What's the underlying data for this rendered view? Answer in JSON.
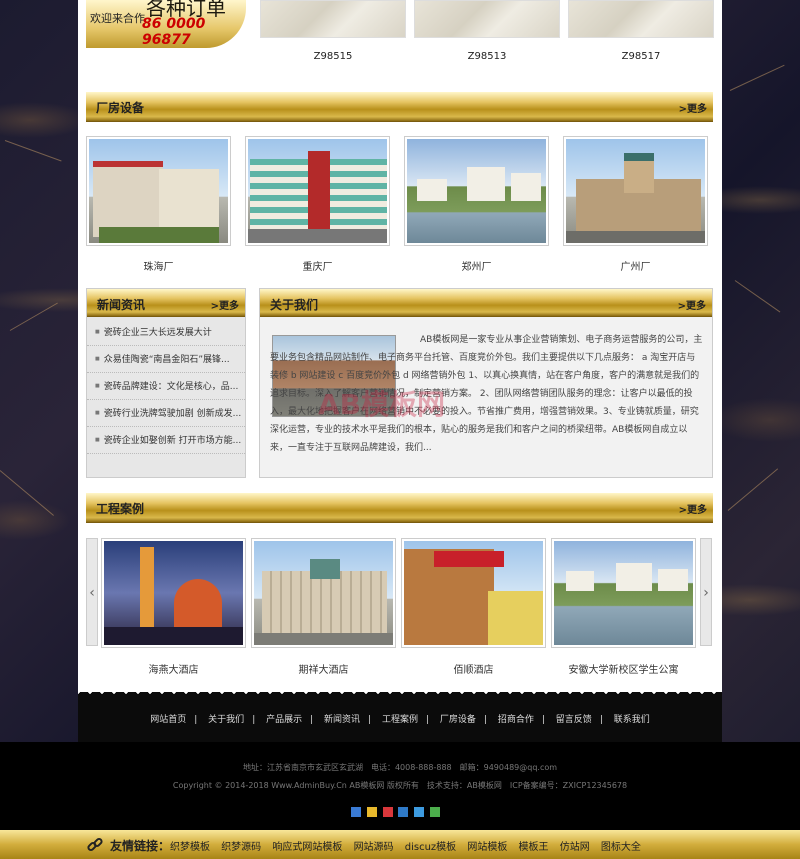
{
  "promo": {
    "line_big": "各种订单",
    "line_small": "欢迎来合作",
    "phone": "86 0000 96877"
  },
  "stones": [
    {
      "code": "Z98515"
    },
    {
      "code": "Z98513"
    },
    {
      "code": "Z98517"
    }
  ],
  "factory": {
    "title": "厂房设备",
    "more": ">更多",
    "items": [
      "珠海厂",
      "重庆厂",
      "郑州厂",
      "广州厂"
    ]
  },
  "news": {
    "title": "新闻资讯",
    "more": ">更多",
    "items": [
      "瓷砖企业三大长远发展大计",
      "众易佳陶瓷“南昌金阳石”展锋...",
      "瓷砖品牌建设：文化是核心，品...",
      "瓷砖行业洗牌驾驶加剧 创新成发...",
      "瓷砖企业如娶创新 打开市场方能..."
    ]
  },
  "about": {
    "title": "关于我们",
    "more": ">更多",
    "text": "AB模板网是一家专业从事企业营销策划、电子商务运营服务的公司，主要业务包含精品网站制作、电子商务平台托管、百度竞价外包。我们主要提供以下几点服务： a 淘宝开店与装修 b 网站建设 c 百度竞价外包 d 网络营销外包 1、以真心换真情，站在客户角度，客户的满意就是我们的追求目标。深入了解客户营销情况，制定营销方案。 2、团队网络营销团队服务的理念：让客户以最低的投入，最大化地把握客户在网络营销中不必要的投入。节省推广费用，增强营销效果。3、专业铸就质量，研究深化运营，专业的技术水平是我们的根本，贴心的服务是我们和客户之间的桥梁纽带。AB模板网自成立以来，一直专注于互联网品牌建设，我们..."
  },
  "cases": {
    "title": "工程案例",
    "more": ">更多",
    "items": [
      "海燕大酒店",
      "期祥大酒店",
      "佰顺酒店",
      "安徽大学新校区学生公寓"
    ],
    "prev_arrow": "‹",
    "next_arrow": "›"
  },
  "watermark": "AB模板网",
  "nav": {
    "items": [
      "网站首页",
      "关于我们",
      "产品展示",
      "新闻资讯",
      "工程案例",
      "厂房设备",
      "招商合作",
      "留言反馈",
      "联系我们"
    ],
    "sep": "|"
  },
  "footer": {
    "address": "地址：江苏省南京市玄武区玄武湖　电话：4008-888-888　邮箱：9490489@qq.com",
    "copyright": "Copyright © 2014-2018 Www.AdminBuy.Cn AB模板网 版权所有　技术支持：AB模板网　ICP备案编号：ZXICP12345678"
  },
  "links": {
    "label": "友情链接：",
    "items": [
      "织梦模板",
      "织梦源码",
      "响应式网站模板",
      "网站源码",
      "discuz模板",
      "网站模板",
      "模板王",
      "仿站网",
      "图标大全"
    ]
  },
  "colors": {
    "gold_light": "#fff7c9",
    "gold_mid": "#d9b84b",
    "gold_dark": "#8b6a12",
    "phone_red": "#cc0000",
    "background_stone": "#171728"
  },
  "share_icons": [
    "qzone-icon",
    "weibo-icon",
    "tencent-weibo-icon",
    "renren-icon",
    "kaixin-icon",
    "wechat-icon"
  ]
}
